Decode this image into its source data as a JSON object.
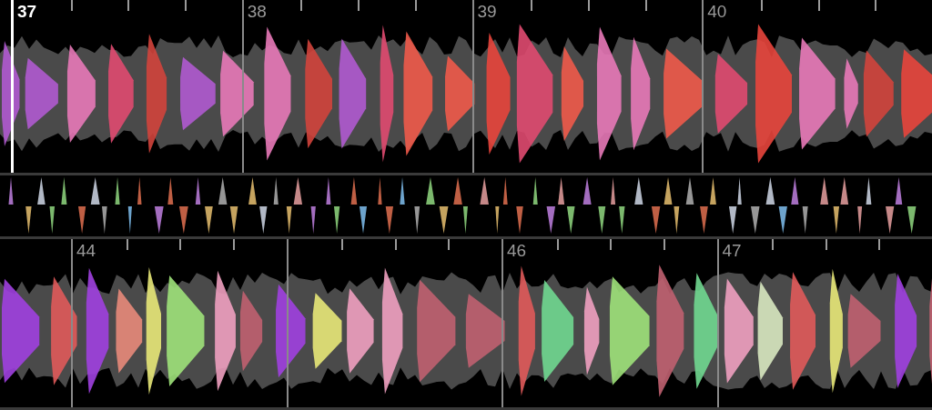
{
  "decks": [
    {
      "bars": [
        {
          "kind": "partial"
        },
        {
          "kind": "full",
          "label": "37",
          "selected": true
        },
        {
          "kind": "full",
          "label": "38",
          "selected": false
        },
        {
          "kind": "full",
          "label": "39",
          "selected": false
        },
        {
          "kind": "full",
          "label": "40",
          "selected": false
        }
      ]
    },
    {
      "bars": [
        {
          "kind": "partial"
        },
        {
          "kind": "full",
          "label": "44",
          "selected": false
        },
        {
          "kind": "full"
        },
        {
          "kind": "full",
          "label": "46",
          "selected": false
        },
        {
          "kind": "full",
          "label": "47",
          "selected": false
        }
      ]
    }
  ]
}
